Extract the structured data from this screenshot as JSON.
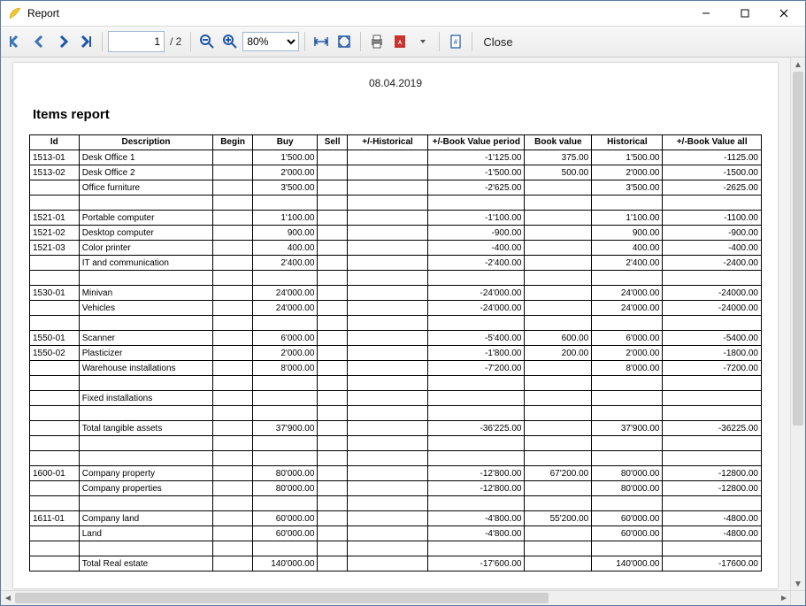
{
  "window": {
    "title": "Report"
  },
  "toolbar": {
    "page_current": "1",
    "page_total": "/ 2",
    "zoom": "80%",
    "close_label": "Close"
  },
  "report": {
    "date": "08.04.2019",
    "title": "Items report",
    "columns": {
      "id": "Id",
      "desc": "Description",
      "begin": "Begin",
      "buy": "Buy",
      "sell": "Sell",
      "hist1": "+/-Historical",
      "bvp": "+/-Book Value period",
      "bv": "Book value",
      "hist2": "Historical",
      "bva": "+/-Book Value all"
    },
    "rows": [
      {
        "id": "1513-01",
        "desc": "Desk Office 1",
        "buy": "1'500.00",
        "bvp": "-1'125.00",
        "bv": "375.00",
        "hist2": "1'500.00",
        "bva": "-1125.00"
      },
      {
        "id": "1513-02",
        "desc": "Desk Office 2",
        "buy": "2'000.00",
        "bvp": "-1'500.00",
        "bv": "500.00",
        "hist2": "2'000.00",
        "bva": "-1500.00"
      },
      {
        "id": "",
        "desc": "Office furniture",
        "buy": "3'500.00",
        "bvp": "-2'625.00",
        "bv": "",
        "hist2": "3'500.00",
        "bva": "-2625.00"
      },
      {
        "blank": true
      },
      {
        "id": "1521-01",
        "desc": "Portable computer",
        "buy": "1'100.00",
        "bvp": "-1'100.00",
        "bv": "",
        "hist2": "1'100.00",
        "bva": "-1100.00"
      },
      {
        "id": "1521-02",
        "desc": "Desktop computer",
        "buy": "900.00",
        "bvp": "-900.00",
        "bv": "",
        "hist2": "900.00",
        "bva": "-900.00"
      },
      {
        "id": "1521-03",
        "desc": "Color printer",
        "buy": "400.00",
        "bvp": "-400.00",
        "bv": "",
        "hist2": "400.00",
        "bva": "-400.00"
      },
      {
        "id": "",
        "desc": "IT and communication",
        "buy": "2'400.00",
        "bvp": "-2'400.00",
        "bv": "",
        "hist2": "2'400.00",
        "bva": "-2400.00"
      },
      {
        "blank": true
      },
      {
        "id": "1530-01",
        "desc": "Minivan",
        "buy": "24'000.00",
        "bvp": "-24'000.00",
        "bv": "",
        "hist2": "24'000.00",
        "bva": "-24000.00"
      },
      {
        "id": "",
        "desc": "Vehicles",
        "buy": "24'000.00",
        "bvp": "-24'000.00",
        "bv": "",
        "hist2": "24'000.00",
        "bva": "-24000.00"
      },
      {
        "blank": true
      },
      {
        "id": "1550-01",
        "desc": "Scanner",
        "buy": "6'000.00",
        "bvp": "-5'400.00",
        "bv": "600.00",
        "hist2": "6'000.00",
        "bva": "-5400.00"
      },
      {
        "id": "1550-02",
        "desc": "Plasticizer",
        "buy": "2'000.00",
        "bvp": "-1'800.00",
        "bv": "200.00",
        "hist2": "2'000.00",
        "bva": "-1800.00"
      },
      {
        "id": "",
        "desc": "Warehouse installations",
        "buy": "8'000.00",
        "bvp": "-7'200.00",
        "bv": "",
        "hist2": "8'000.00",
        "bva": "-7200.00"
      },
      {
        "blank": true
      },
      {
        "id": "",
        "desc": "Fixed installations",
        "buy": "",
        "bvp": "",
        "bv": "",
        "hist2": "",
        "bva": ""
      },
      {
        "blank": true
      },
      {
        "id": "",
        "desc": "Total tangible assets",
        "buy": "37'900.00",
        "bvp": "-36'225.00",
        "bv": "",
        "hist2": "37'900.00",
        "bva": "-36225.00"
      },
      {
        "blank": true
      },
      {
        "blank": true
      },
      {
        "id": "1600-01",
        "desc": "Company property",
        "buy": "80'000.00",
        "bvp": "-12'800.00",
        "bv": "67'200.00",
        "hist2": "80'000.00",
        "bva": "-12800.00"
      },
      {
        "id": "",
        "desc": "Company properties",
        "buy": "80'000.00",
        "bvp": "-12'800.00",
        "bv": "",
        "hist2": "80'000.00",
        "bva": "-12800.00"
      },
      {
        "blank": true
      },
      {
        "id": "1611-01",
        "desc": "Company land",
        "buy": "60'000.00",
        "bvp": "-4'800.00",
        "bv": "55'200.00",
        "hist2": "60'000.00",
        "bva": "-4800.00"
      },
      {
        "id": "",
        "desc": "Land",
        "buy": "60'000.00",
        "bvp": "-4'800.00",
        "bv": "",
        "hist2": "60'000.00",
        "bva": "-4800.00"
      },
      {
        "blank": true
      },
      {
        "id": "",
        "desc": "Total Real estate",
        "buy": "140'000.00",
        "bvp": "-17'600.00",
        "bv": "",
        "hist2": "140'000.00",
        "bva": "-17600.00"
      }
    ]
  }
}
